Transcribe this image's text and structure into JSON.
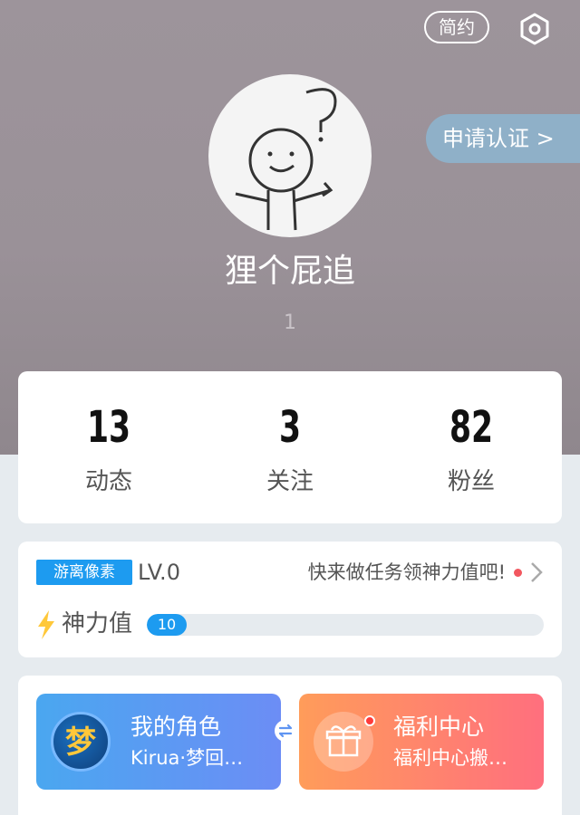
{
  "header": {
    "brief_label": "简约",
    "verify_label": "申请认证 >"
  },
  "profile": {
    "nickname": "狸个屁追",
    "uid": "1"
  },
  "stats": [
    {
      "value": "13",
      "label": "动态"
    },
    {
      "value": "3",
      "label": "关注"
    },
    {
      "value": "82",
      "label": "粉丝"
    }
  ],
  "level": {
    "tag": "游离像素",
    "lv": "LV.0",
    "task_text": "快来做任务领神力值吧!",
    "power_label": "神力值",
    "power_value": "10",
    "power_progress": 0.1
  },
  "tiles": {
    "role": {
      "title": "我的角色",
      "subtitle": "Kirua·梦回…",
      "icon_text": "梦"
    },
    "welfare": {
      "title": "福利中心",
      "subtitle": "福利中心搬…"
    }
  },
  "colors": {
    "accent": "#1d9bf0",
    "hero_bg": "#9d949b",
    "verify_bg": "#8fb0c8",
    "notify_red": "#f2575f"
  },
  "icons": [
    "settings-gear-icon",
    "chevron-right-icon",
    "lightning-bolt-icon",
    "swap-icon",
    "gift-icon"
  ]
}
